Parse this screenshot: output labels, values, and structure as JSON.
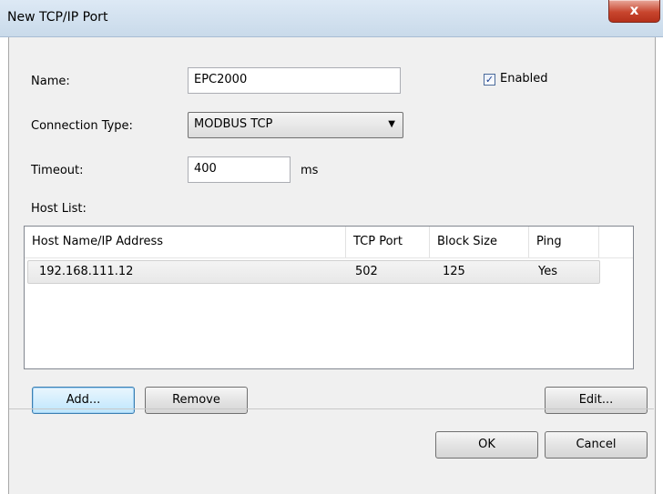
{
  "window": {
    "title": "New TCP/IP Port",
    "close_symbol": "x"
  },
  "form": {
    "name_label": "Name:",
    "name_value": "EPC2000",
    "enabled_label": "Enabled",
    "enabled_checked": true,
    "connection_label": "Connection Type:",
    "connection_value": "MODBUS TCP",
    "timeout_label": "Timeout:",
    "timeout_value": "400",
    "timeout_unit": "ms",
    "host_list_label": "Host List:"
  },
  "host_list": {
    "columns": [
      "Host Name/IP Address",
      "TCP Port",
      "Block Size",
      "Ping"
    ],
    "rows": [
      {
        "host": "192.168.111.12",
        "port": "502",
        "block_size": "125",
        "ping": "Yes"
      }
    ]
  },
  "buttons": {
    "add": "Add...",
    "remove": "Remove",
    "edit": "Edit...",
    "ok": "OK",
    "cancel": "Cancel"
  },
  "icons": {
    "dropdown": "chevron-down-icon",
    "checkbox": "check-icon"
  }
}
